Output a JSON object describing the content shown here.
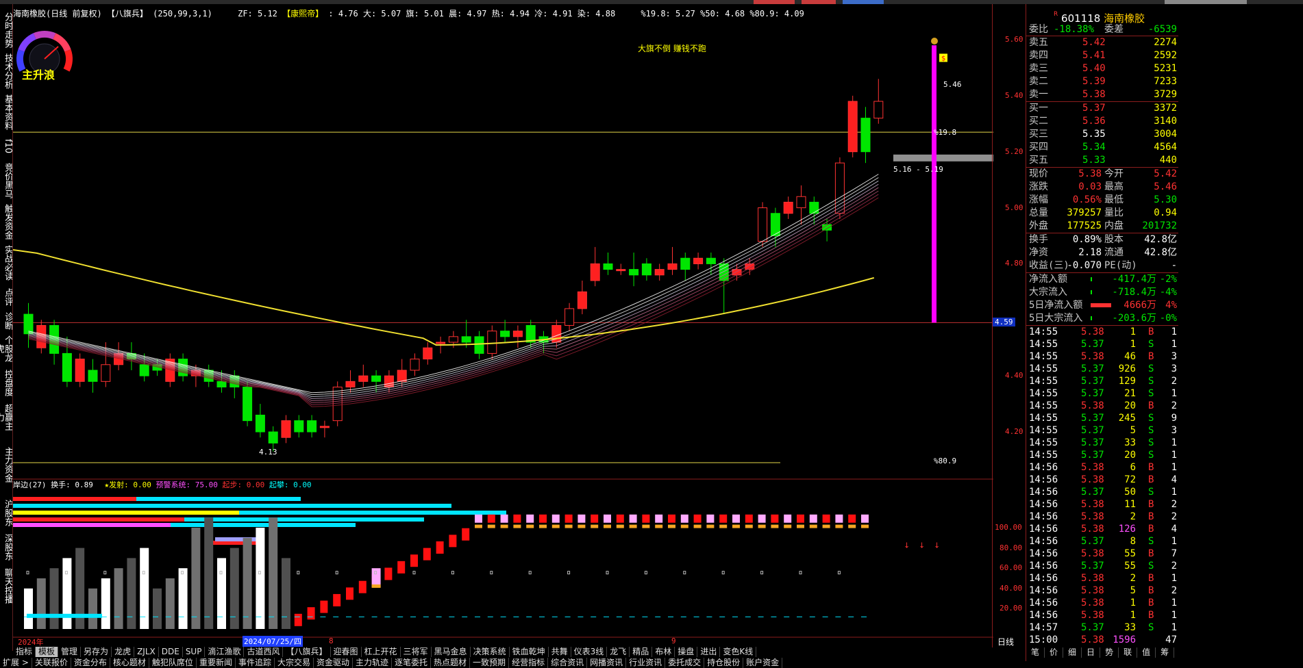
{
  "title_bar": {
    "stock_title": "海南橡胶(日线 前复权)",
    "indicator": "【八旗兵】",
    "params": "(250,99,3,1)",
    "zf": "ZF: 5.12",
    "kangxi": "【康熙帝】",
    "kangxi_vals": ": 4.76 大: 5.07 旗: 5.01 晨: 4.97 热: 4.94 冷: 4.91 染: 4.88",
    "pct_line": "%19.8: 5.27 %50: 4.68 %80.9: 4.09"
  },
  "gauge_label": "主升浪",
  "annotation": "大旗不倒 赚钱不跑",
  "price_labels": {
    "high": "5.46",
    "pct198": "%19.8",
    "range": "5.16 - 5.19",
    "low": "4.13",
    "pct809": "%80.9"
  },
  "axis_main": [
    "5.60",
    "5.40",
    "5.20",
    "5.00",
    "4.80",
    "4.59",
    "4.40",
    "4.20"
  ],
  "axis_sub": [
    "100.00",
    "80.00",
    "60.00",
    "40.00",
    "20.00"
  ],
  "sub_header": {
    "name": "岸边(27)",
    "turnover": "换手: 0.89",
    "fire": "★发射: 0.00",
    "warn": "预警系统: 75.00",
    "start": "起步: 0.00",
    "jump": "起攀: 0.00"
  },
  "time_axis": {
    "year": "2024年",
    "date": "2024/07/25/四",
    "m8": "8",
    "m9": "9",
    "day_label": "日线"
  },
  "left_tabs": [
    "分时走势",
    "技术分析",
    "基本资料",
    "f10",
    "竞价黑马",
    "触发资金",
    "实战必读",
    "点评",
    "诊断",
    "个股龙虎",
    "控盘度",
    "超赢主力",
    "主力资金",
    "沪股东",
    "深股东",
    "聊天控播"
  ],
  "bottom_tabs": [
    "指标",
    "模板",
    "管理",
    "另存为",
    "龙虎",
    "ZJLX",
    "DDE",
    "SUP",
    "滴江渔歌",
    "古道西风",
    "【八旗兵】",
    "迎春图",
    "杠上开花",
    "三将军",
    "黑马金息",
    "决策系统",
    "铁血乾坤",
    "共舞",
    "仪表3线",
    "龙飞",
    "精品",
    "布林",
    "操盘",
    "进出",
    "变色K线"
  ],
  "bottom_tabs2": [
    "扩展 >",
    "关联报价",
    "资金分布",
    "核心题材",
    "触犯队席位",
    "重要新闻",
    "事件追踪",
    "大宗交易",
    "资金驱动",
    "主力轨迹",
    "逐笔委托",
    "热点题材",
    "一致预期",
    "经营指标",
    "综合资讯",
    "网播资讯",
    "行业资讯",
    "委托成交",
    "持仓股份",
    "账户资金"
  ],
  "quote": {
    "code": "601118",
    "name": "海南橡胶",
    "weibi_label": "委比",
    "weibi": "-18.38%",
    "weicha_label": "委差",
    "weicha": "-6539",
    "sells": [
      {
        "label": "卖五",
        "price": "5.42",
        "vol": "2274"
      },
      {
        "label": "卖四",
        "price": "5.41",
        "vol": "2592"
      },
      {
        "label": "卖三",
        "price": "5.40",
        "vol": "5231"
      },
      {
        "label": "卖二",
        "price": "5.39",
        "vol": "7233"
      },
      {
        "label": "卖一",
        "price": "5.38",
        "vol": "3729"
      }
    ],
    "buys": [
      {
        "label": "买一",
        "price": "5.37",
        "vol": "3372"
      },
      {
        "label": "买二",
        "price": "5.36",
        "vol": "3140"
      },
      {
        "label": "买三",
        "price": "5.35",
        "vol": "3004"
      },
      {
        "label": "买四",
        "price": "5.34",
        "vol": "4564"
      },
      {
        "label": "买五",
        "price": "5.33",
        "vol": "440"
      }
    ],
    "stats": [
      {
        "l1": "现价",
        "v1": "5.38",
        "l2": "今开",
        "v2": "5.42"
      },
      {
        "l1": "涨跌",
        "v1": "0.03",
        "l2": "最高",
        "v2": "5.46"
      },
      {
        "l1": "涨幅",
        "v1": "0.56%",
        "l2": "最低",
        "v2": "5.30"
      },
      {
        "l1": "总量",
        "v1": "379257",
        "l2": "量比",
        "v2": "0.94"
      },
      {
        "l1": "外盘",
        "v1": "177525",
        "l2": "内盘",
        "v2": "201732"
      }
    ],
    "stats2": [
      {
        "l1": "换手",
        "v1": "0.89%",
        "l2": "股本",
        "v2": "42.8亿"
      },
      {
        "l1": "净资",
        "v1": "2.18",
        "l2": "流通",
        "v2": "42.8亿"
      },
      {
        "l1": "收益(三)",
        "v1": "-0.070",
        "l2": "PE(动)",
        "v2": "-"
      }
    ],
    "flows": [
      {
        "label": "净流入额",
        "val": "-417.4万",
        "pct": "-2%"
      },
      {
        "label": "大宗流入",
        "val": "-718.4万",
        "pct": "-4%"
      },
      {
        "label": "5日净流入额",
        "val": "4666万",
        "pct": "4%"
      },
      {
        "label": "5日大宗流入",
        "val": "-203.6万",
        "pct": "-0%"
      }
    ],
    "ticks": [
      [
        "14:55",
        "5.38",
        "1",
        "B",
        "1"
      ],
      [
        "14:55",
        "5.37",
        "1",
        "S",
        "1"
      ],
      [
        "14:55",
        "5.38",
        "46",
        "B",
        "3"
      ],
      [
        "14:55",
        "5.37",
        "926",
        "S",
        "3"
      ],
      [
        "14:55",
        "5.37",
        "129",
        "S",
        "2"
      ],
      [
        "14:55",
        "5.37",
        "21",
        "S",
        "1"
      ],
      [
        "14:55",
        "5.38",
        "20",
        "B",
        "2"
      ],
      [
        "14:55",
        "5.37",
        "245",
        "S",
        "9"
      ],
      [
        "14:55",
        "5.37",
        "5",
        "S",
        "3"
      ],
      [
        "14:55",
        "5.37",
        "33",
        "S",
        "1"
      ],
      [
        "14:55",
        "5.37",
        "20",
        "S",
        "1"
      ],
      [
        "14:56",
        "5.38",
        "6",
        "B",
        "1"
      ],
      [
        "14:56",
        "5.38",
        "72",
        "B",
        "4"
      ],
      [
        "14:56",
        "5.37",
        "50",
        "S",
        "1"
      ],
      [
        "14:56",
        "5.38",
        "11",
        "B",
        "2"
      ],
      [
        "14:56",
        "5.38",
        "2",
        "B",
        "2"
      ],
      [
        "14:56",
        "5.38",
        "126",
        "B",
        "4"
      ],
      [
        "14:56",
        "5.37",
        "8",
        "S",
        "1"
      ],
      [
        "14:56",
        "5.38",
        "55",
        "B",
        "7"
      ],
      [
        "14:56",
        "5.37",
        "55",
        "S",
        "2"
      ],
      [
        "14:56",
        "5.38",
        "2",
        "B",
        "1"
      ],
      [
        "14:56",
        "5.38",
        "5",
        "B",
        "2"
      ],
      [
        "14:56",
        "5.38",
        "1",
        "B",
        "1"
      ],
      [
        "14:56",
        "5.38",
        "1",
        "B",
        "1"
      ],
      [
        "14:57",
        "5.37",
        "33",
        "S",
        "1"
      ],
      [
        "15:00",
        "5.38",
        "1596",
        "",
        "47"
      ]
    ],
    "bottom_tabs": [
      "笔",
      "价",
      "细",
      "日",
      "势",
      "联",
      "值",
      "筹"
    ]
  },
  "colors": {
    "up": "#ff3232",
    "down": "#00e600",
    "yellow_ma": "#f0e030",
    "magenta": "#ff00ff",
    "cyan": "#00e5ff",
    "pink": "#ffaaff",
    "orange": "#f5a623"
  }
}
